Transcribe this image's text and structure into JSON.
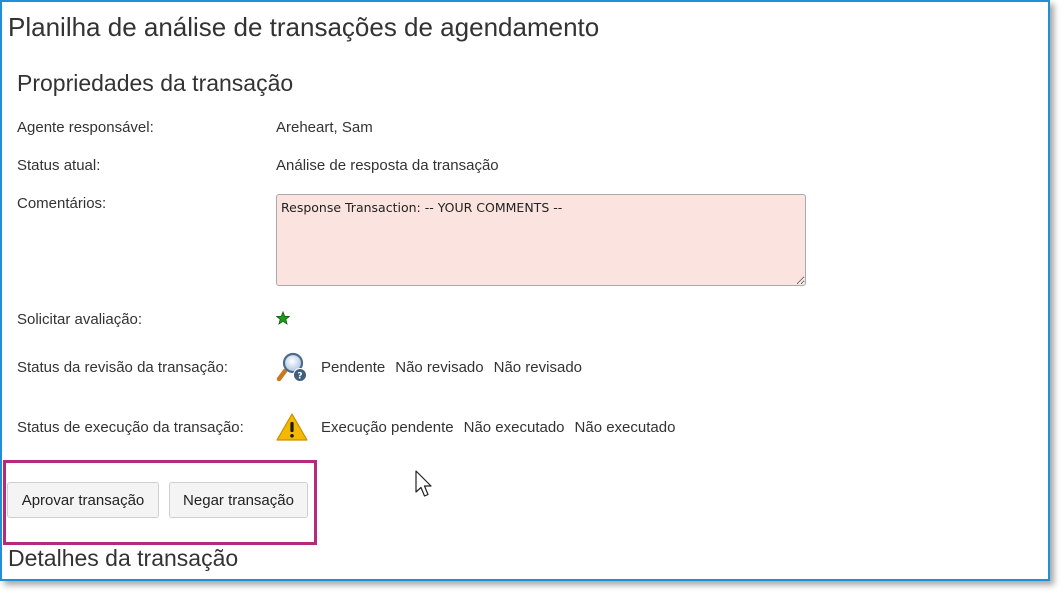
{
  "page": {
    "title": "Planilha de análise de transações de agendamento"
  },
  "properties": {
    "section_title": "Propriedades da transação",
    "assigned_agent_label": "Agente responsável:",
    "assigned_agent_value": "Areheart, Sam",
    "current_status_label": "Status atual:",
    "current_status_value": "Análise de resposta da transação",
    "comments_label": "Comentários:",
    "comments_value": "Response Transaction: -- YOUR COMMENTS --",
    "request_review_label": "Solicitar avaliação:",
    "review_status_label": "Status da revisão da transação:",
    "review_status": [
      "Pendente",
      "Não revisado",
      "Não revisado"
    ],
    "execution_status_label": "Status de execução da transação:",
    "execution_status": [
      "Execução pendente",
      "Não executado",
      "Não executado"
    ]
  },
  "actions": {
    "approve_label": "Aprovar transação",
    "deny_label": "Negar transação"
  },
  "details": {
    "section_title": "Detalhes da transação"
  },
  "icons": {
    "request_review": "green-star-icon",
    "review_status": "magnifier-icon",
    "execution_status": "warning-icon"
  },
  "colors": {
    "frame_border": "#1f8fd6",
    "comments_bg": "#fbe4e0",
    "highlight": "#b5297f",
    "star": "#1a9e1a",
    "warning": "#f5b800"
  }
}
